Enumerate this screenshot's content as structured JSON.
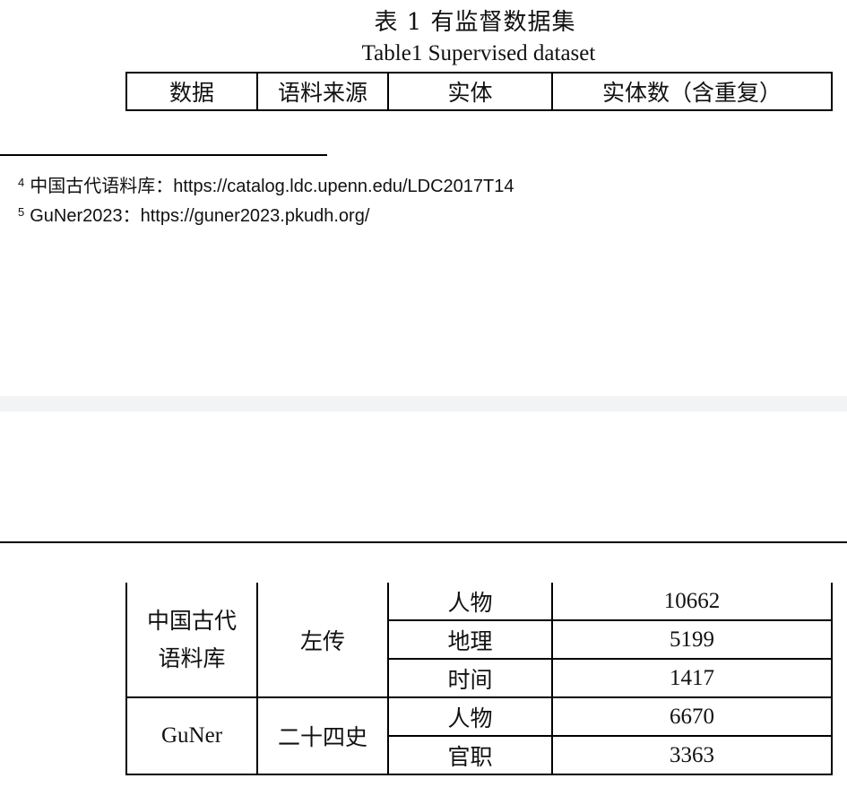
{
  "caption": {
    "cn": "表 1  有监督数据集",
    "en": "Table1 Supervised dataset"
  },
  "table": {
    "headers": [
      "数据",
      "语料来源",
      "实体",
      "实体数（含重复）"
    ],
    "groups": [
      {
        "dataset": "中国古代语料库",
        "source": "左传",
        "rows": [
          {
            "entity": "人物",
            "count": "10662"
          },
          {
            "entity": "地理",
            "count": "5199"
          },
          {
            "entity": "时间",
            "count": "1417"
          }
        ]
      },
      {
        "dataset": "GuNer",
        "source": "二十四史",
        "rows": [
          {
            "entity": "人物",
            "count": "6670"
          },
          {
            "entity": "官职",
            "count": "3363"
          }
        ]
      }
    ]
  },
  "footnotes": [
    {
      "mark": "4",
      "text": "中国古代语料库：https://catalog.ldc.upenn.edu/LDC2017T14"
    },
    {
      "mark": "5",
      "text": "GuNer2023：https://guner2023.pkudh.org/"
    }
  ]
}
